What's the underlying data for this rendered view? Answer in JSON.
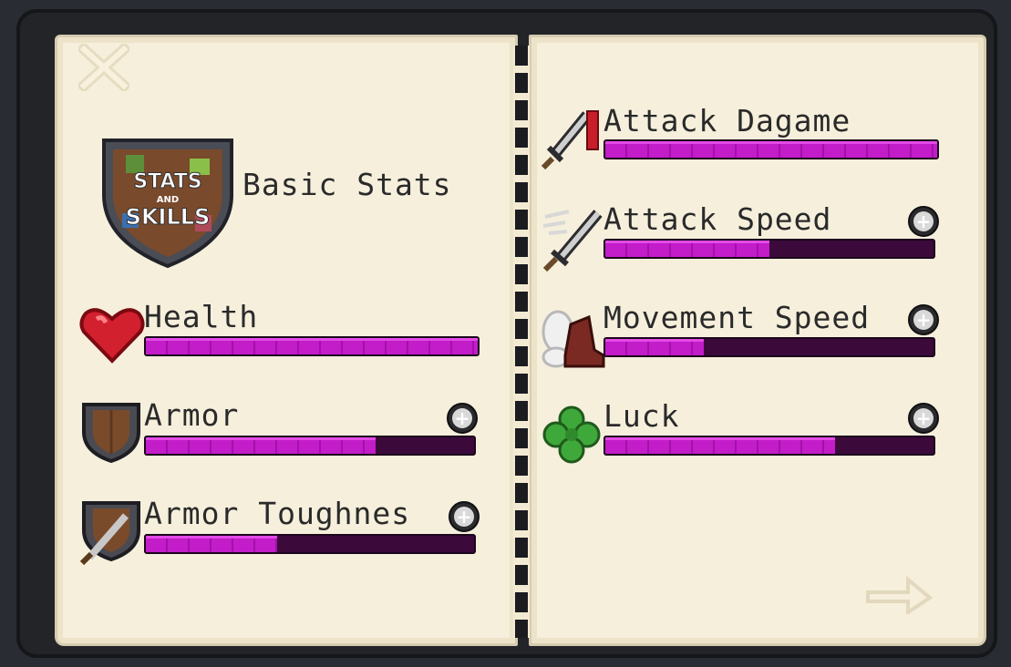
{
  "header": {
    "logo_text": "STATS AND SKILLS",
    "title": "Basic Stats"
  },
  "icons": {
    "close": "close-icon",
    "next": "next-page-arrow-icon"
  },
  "stats": [
    {
      "id": "health",
      "label": "Health",
      "icon": "heart-icon",
      "fill": 1.0,
      "upgradable": false
    },
    {
      "id": "armor",
      "label": "Armor",
      "icon": "shield-icon",
      "fill": 0.7,
      "upgradable": true
    },
    {
      "id": "armor_toughness",
      "label": "Armor Toughnes",
      "icon": "shield-sword-icon",
      "fill": 0.4,
      "upgradable": true
    },
    {
      "id": "attack_damage",
      "label": "Attack Dagame",
      "icon": "sword-damage-icon",
      "fill": 1.0,
      "upgradable": false
    },
    {
      "id": "attack_speed",
      "label": "Attack Speed",
      "icon": "sword-speed-icon",
      "fill": 0.5,
      "upgradable": true
    },
    {
      "id": "movement_speed",
      "label": "Movement Speed",
      "icon": "boot-icon",
      "fill": 0.3,
      "upgradable": true
    },
    {
      "id": "luck",
      "label": "Luck",
      "icon": "clover-icon",
      "fill": 0.7,
      "upgradable": true
    }
  ],
  "colors": {
    "bar_fill": "#c31cc9",
    "bar_empty": "#3b0a3b",
    "page": "#f6efdc"
  }
}
